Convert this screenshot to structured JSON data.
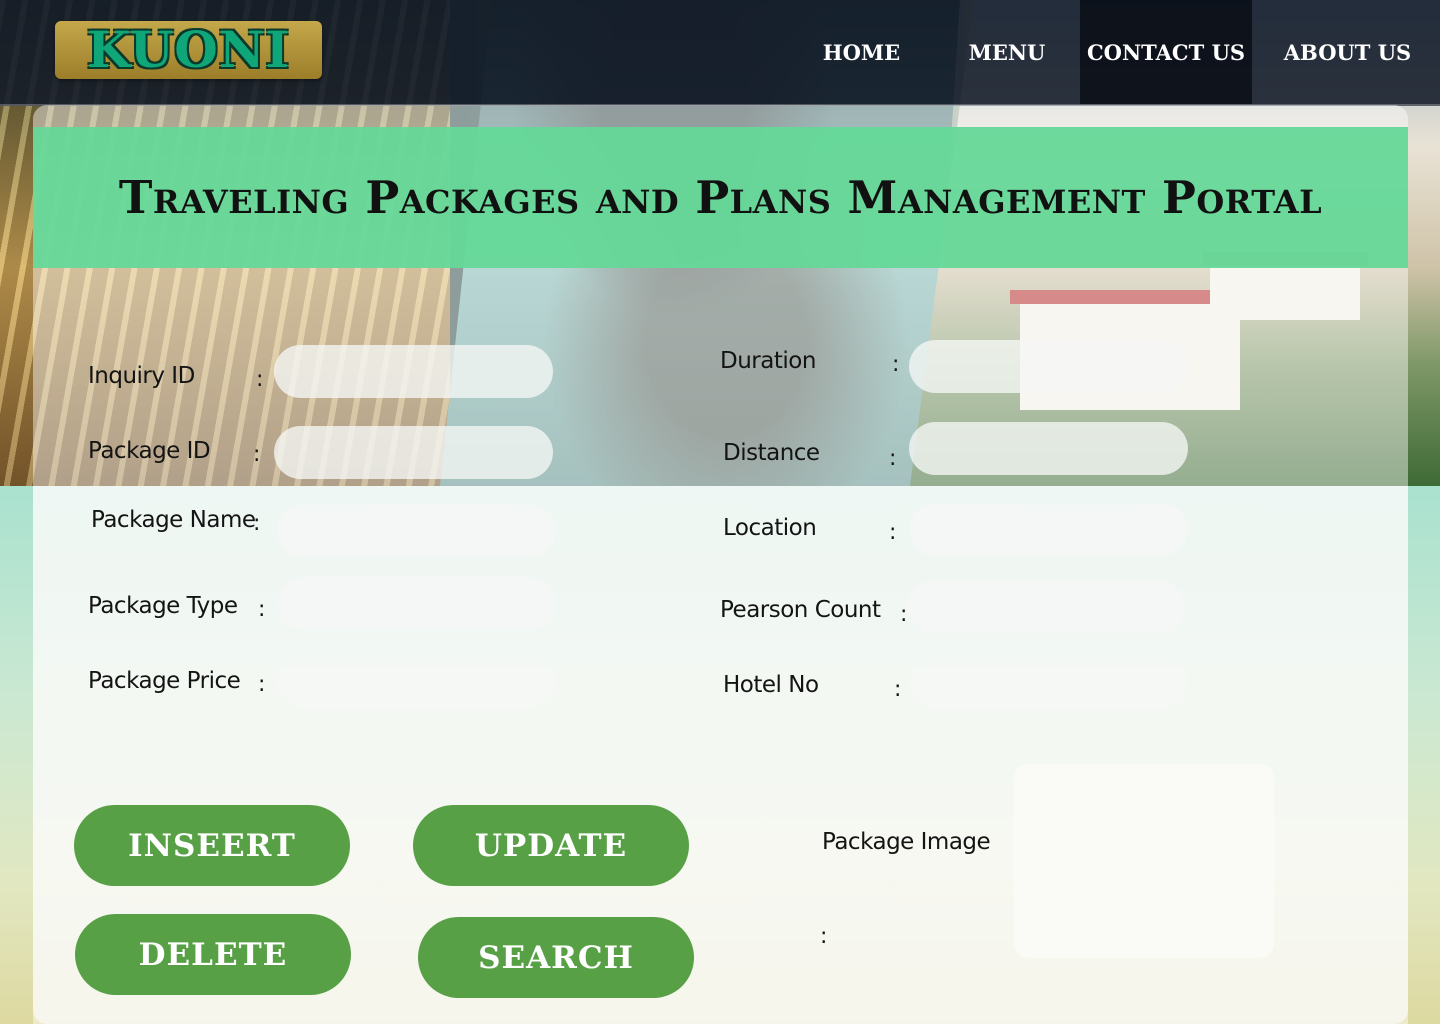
{
  "header": {
    "logo_text": "KUONI",
    "nav": {
      "home": "HOME",
      "menu": "MENU",
      "contact": "CONTACT US",
      "about": "ABOUT  US"
    }
  },
  "page_title": "Traveling Packages and Plans Management Portal",
  "form": {
    "colon": ":",
    "left": [
      {
        "label": "Inquiry ID",
        "value": ""
      },
      {
        "label": "Package ID",
        "value": ""
      },
      {
        "label": "Package Name",
        "value": ""
      },
      {
        "label": "Package Type",
        "value": ""
      },
      {
        "label": "Package Price",
        "value": ""
      }
    ],
    "right": [
      {
        "label": "Duration",
        "value": ""
      },
      {
        "label": "Distance",
        "value": ""
      },
      {
        "label": "Location",
        "value": ""
      },
      {
        "label": "Pearson Count",
        "value": ""
      },
      {
        "label": "Hotel No",
        "value": ""
      }
    ],
    "image_label": "Package Image"
  },
  "buttons": {
    "insert": "INSEERT",
    "update": "UPDATE",
    "delete": "DELETE",
    "search": "SEARCH"
  },
  "colors": {
    "header_bg": "#121a28",
    "title_band": "#65d898",
    "button_green": "#58a046",
    "logo_gold": "#c4a84a",
    "logo_text": "#0fa77a"
  }
}
